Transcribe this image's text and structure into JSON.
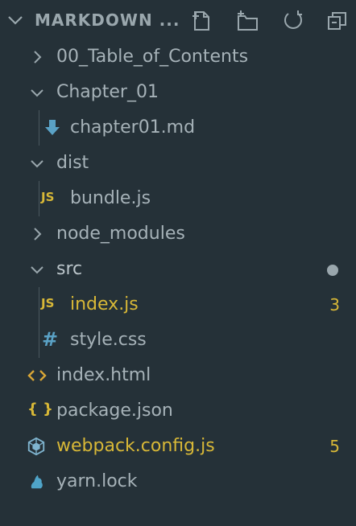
{
  "explorer": {
    "title": "MARKDOWN ...",
    "actions": [
      {
        "name": "new-file-icon"
      },
      {
        "name": "new-folder-icon"
      },
      {
        "name": "refresh-icon"
      },
      {
        "name": "collapse-all-icon"
      }
    ]
  },
  "tree": [
    {
      "label": "00_Table_of_Contents",
      "type": "folder",
      "expanded": false
    },
    {
      "label": "Chapter_01",
      "type": "folder",
      "expanded": true
    },
    {
      "label": "chapter01.md",
      "type": "markdown"
    },
    {
      "label": "dist",
      "type": "folder",
      "expanded": true
    },
    {
      "label": "bundle.js",
      "type": "js",
      "badge": "JS"
    },
    {
      "label": "node_modules",
      "type": "folder",
      "expanded": false
    },
    {
      "label": "src",
      "type": "folder",
      "expanded": true,
      "modified_dot": true
    },
    {
      "label": "index.js",
      "type": "js",
      "badge": "JS",
      "problems": "3"
    },
    {
      "label": "style.css",
      "type": "css",
      "badge": "#"
    },
    {
      "label": "index.html",
      "type": "html"
    },
    {
      "label": "package.json",
      "type": "json",
      "badge": "{ }"
    },
    {
      "label": "webpack.config.js",
      "type": "webpack",
      "problems": "5"
    },
    {
      "label": "yarn.lock",
      "type": "yarn"
    }
  ],
  "colors": {
    "background": "#253138",
    "text": "#a6b2b8",
    "warning": "#d8b837",
    "css_icon": "#5aa2c6",
    "webpack_icon": "#7fb4cf",
    "yarn_icon": "#4fa4c8"
  }
}
